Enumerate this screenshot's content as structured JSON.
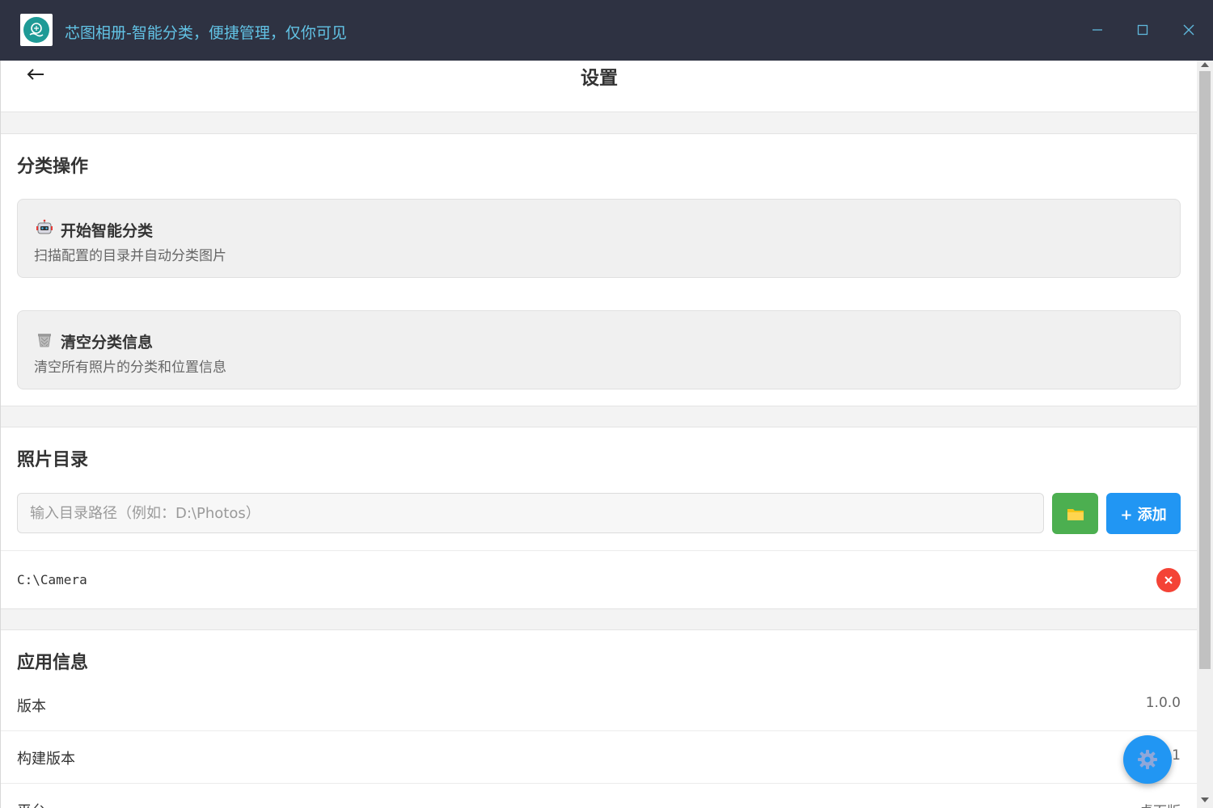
{
  "window": {
    "title": "芯图相册-智能分类，便捷管理，仅你可见",
    "logo_icon": "app-logo-icon",
    "minimize_icon": "minimize-icon",
    "maximize_icon": "maximize-icon",
    "close_icon": "close-icon"
  },
  "header": {
    "back_icon": "arrow-left-icon",
    "title": "设置"
  },
  "classification": {
    "section_title": "分类操作",
    "start": {
      "icon": "robot-icon",
      "title": "开始智能分类",
      "description": "扫描配置的目录并自动分类图片"
    },
    "clear": {
      "icon": "trash-icon",
      "title": "清空分类信息",
      "description": "清空所有照片的分类和位置信息"
    }
  },
  "photo_dirs": {
    "section_title": "照片目录",
    "input_value": "",
    "input_placeholder": "输入目录路径（例如：D:\\Photos）",
    "browse_icon": "folder-icon",
    "add_label": "+ 添加",
    "items": [
      {
        "path": "C:\\Camera",
        "remove_icon": "remove-icon"
      }
    ]
  },
  "app_info": {
    "section_title": "应用信息",
    "rows": [
      {
        "label": "版本",
        "value": "1.0.0"
      },
      {
        "label": "构建版本",
        "value": "2021"
      },
      {
        "label": "平台",
        "value": "桌面版"
      }
    ]
  },
  "fab": {
    "icon": "gear-icon"
  },
  "colors": {
    "titlebar_bg": "#2e3242",
    "title_text": "#62c3e5",
    "primary": "#2196f3",
    "success": "#4caf50",
    "danger": "#f44336"
  }
}
